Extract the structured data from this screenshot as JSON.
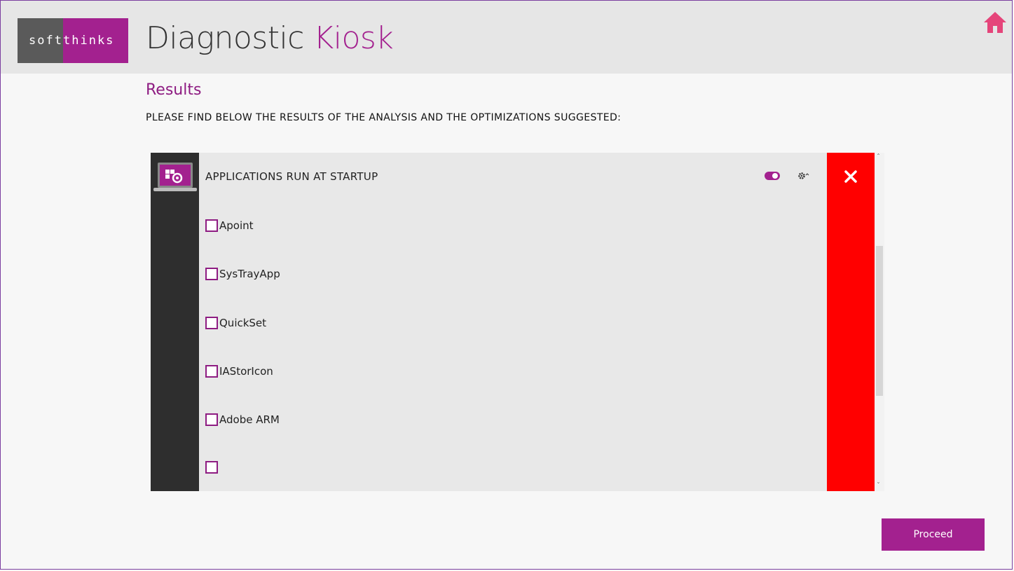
{
  "header": {
    "logo_soft": "soft",
    "logo_thinks": "thinks",
    "title_main": "Diagnostic",
    "title_accent": "Kiosk"
  },
  "page": {
    "section_title": "Results",
    "subtitle": "PLEASE FIND BELOW THE RESULTS OF THE ANALYSIS AND THE OPTIMIZATIONS SUGGESTED:"
  },
  "panel": {
    "heading": "APPLICATIONS RUN AT STARTUP",
    "toggle_state": "on",
    "status": "fail",
    "items": [
      {
        "label": "Apoint",
        "checked": false
      },
      {
        "label": "SysTrayApp",
        "checked": false
      },
      {
        "label": "QuickSet",
        "checked": false
      },
      {
        "label": "IAStorIcon",
        "checked": false
      },
      {
        "label": "Adobe ARM",
        "checked": false
      },
      {
        "label": "",
        "checked": false
      }
    ]
  },
  "buttons": {
    "proceed": "Proceed"
  },
  "icons": {
    "home": "home-icon",
    "laptop": "laptop-settings-icon",
    "gear": "gear-icon",
    "close": "close-icon"
  },
  "colors": {
    "accent": "#a3218f",
    "fail": "#ff0000",
    "header_bg": "#e6e6e6",
    "home_icon": "#e5457a"
  }
}
